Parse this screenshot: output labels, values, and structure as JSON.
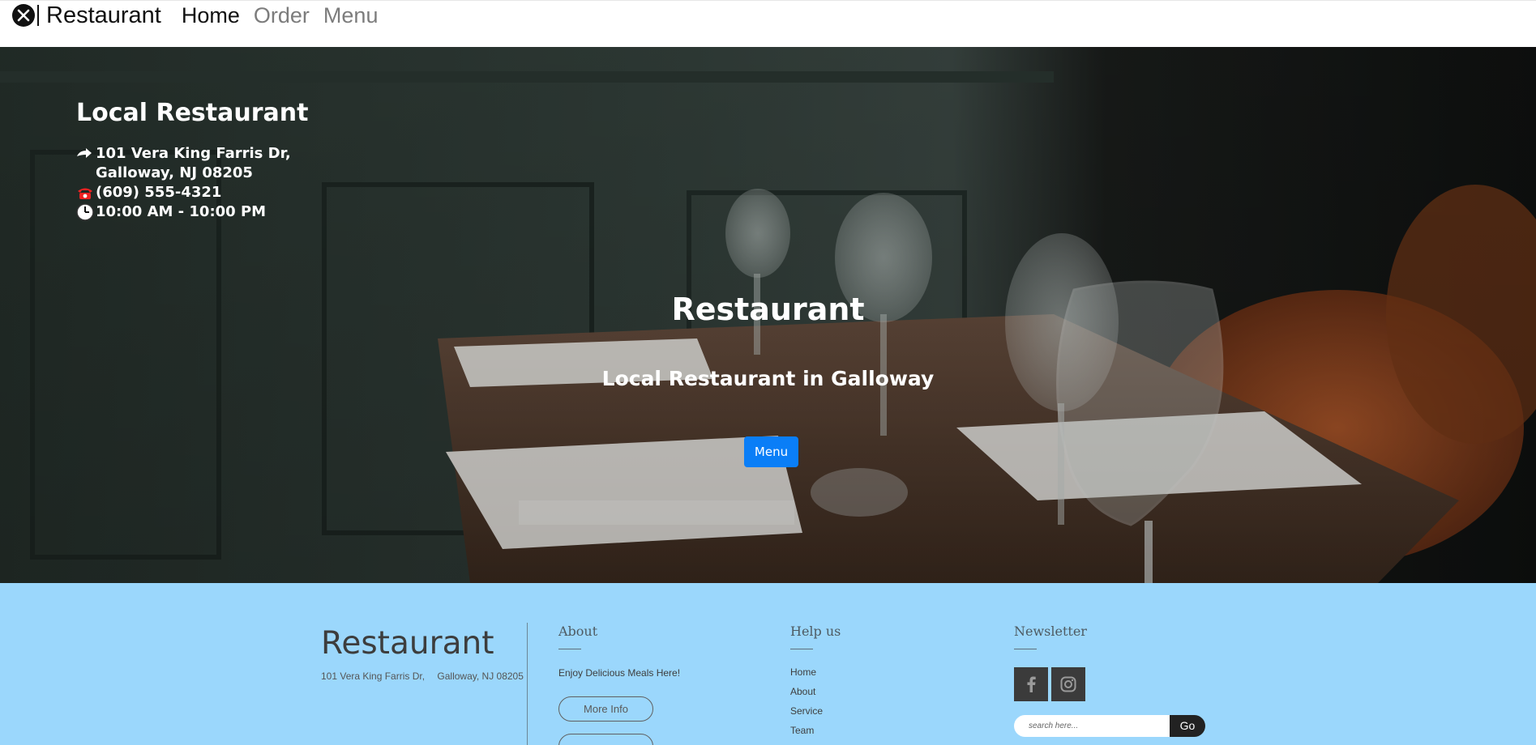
{
  "navbar": {
    "brand": "Restaurant",
    "brand_icon": "fork-knife-plate-icon",
    "links": [
      {
        "label": "Home",
        "active": true
      },
      {
        "label": "Order",
        "active": false
      },
      {
        "label": "Menu",
        "active": false
      }
    ]
  },
  "hero": {
    "info_title": "Local Restaurant",
    "address_icon": "arrow-right-icon",
    "address_line1": "101 Vera King Farris Dr,",
    "address_line2": "Galloway, NJ 08205",
    "phone_icon": "telephone-icon",
    "phone": "(609) 555-4321",
    "hours_icon": "clock-icon",
    "hours": "10:00 AM - 10:00 PM",
    "title": "Restaurant",
    "subtitle": "Local Restaurant in Galloway",
    "button_label": "Menu",
    "accent_color": "#0a7ef7"
  },
  "footer": {
    "brand": "Restaurant",
    "address_part1": "101 Vera King Farris Dr,",
    "address_part2": "Galloway, NJ 08205",
    "background_color": "#9bd7fc",
    "about": {
      "heading": "About",
      "text": "Enjoy Delicious Meals Here!",
      "button_label": "More Info",
      "button2_label": ""
    },
    "help": {
      "heading": "Help us",
      "links": [
        "Home",
        "About",
        "Service",
        "Team"
      ]
    },
    "newsletter": {
      "heading": "Newsletter",
      "social_icons": [
        "facebook-icon",
        "instagram-icon"
      ],
      "search_placeholder": "search here...",
      "go_label": "Go"
    }
  }
}
